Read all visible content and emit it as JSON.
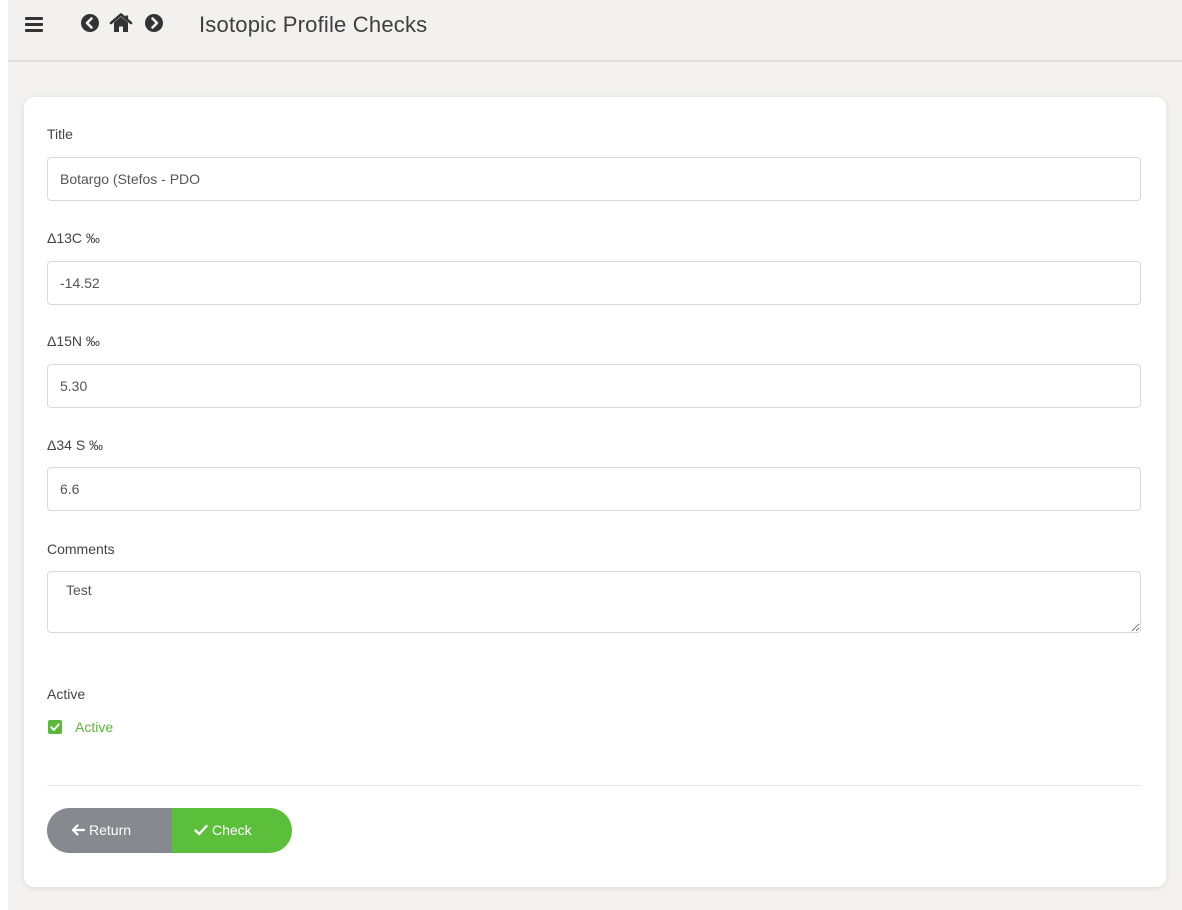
{
  "header": {
    "title": "Isotopic Profile Checks",
    "icons": [
      "menu-icon",
      "back-icon",
      "home-icon",
      "forward-icon"
    ]
  },
  "form": {
    "title_label": "Title",
    "title_value": "Botargo (Stefos - PDO",
    "c13_label": "Δ13C ‰",
    "c13_value": "-14.52",
    "n15_label": "Δ15N ‰",
    "n15_value": "5.30",
    "s34_label": "Δ34 S ‰",
    "s34_value": "6.6",
    "comments_label": "Comments",
    "comments_value": "Test",
    "active_label": "Active",
    "active_checkbox_label": "Active",
    "active_checked": true
  },
  "buttons": {
    "return_label": "Return",
    "check_label": "Check"
  },
  "colors": {
    "accent_green": "#5cb83c",
    "return_gray": "#868a90",
    "background": "#f3f2f0"
  }
}
